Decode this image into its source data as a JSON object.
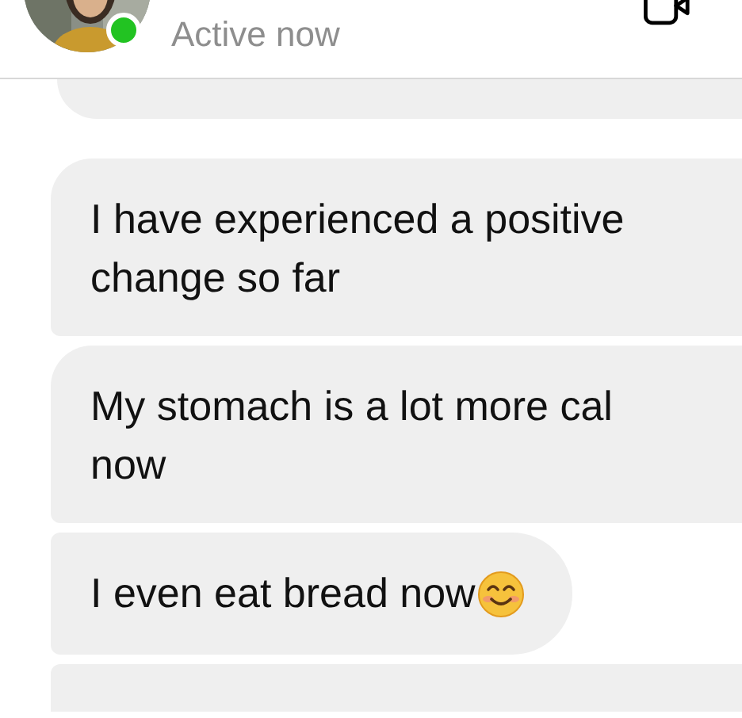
{
  "header": {
    "status": "Active now",
    "online": true
  },
  "messages": [
    {
      "kind": "partial"
    },
    {
      "kind": "text",
      "text": "I have experienced a positive\nchange so far",
      "emoji": false
    },
    {
      "kind": "text",
      "text": "My stomach is a lot more cal\nnow",
      "emoji": false
    },
    {
      "kind": "text",
      "text": "I even eat bread now",
      "emoji": true
    },
    {
      "kind": "partial"
    }
  ]
}
